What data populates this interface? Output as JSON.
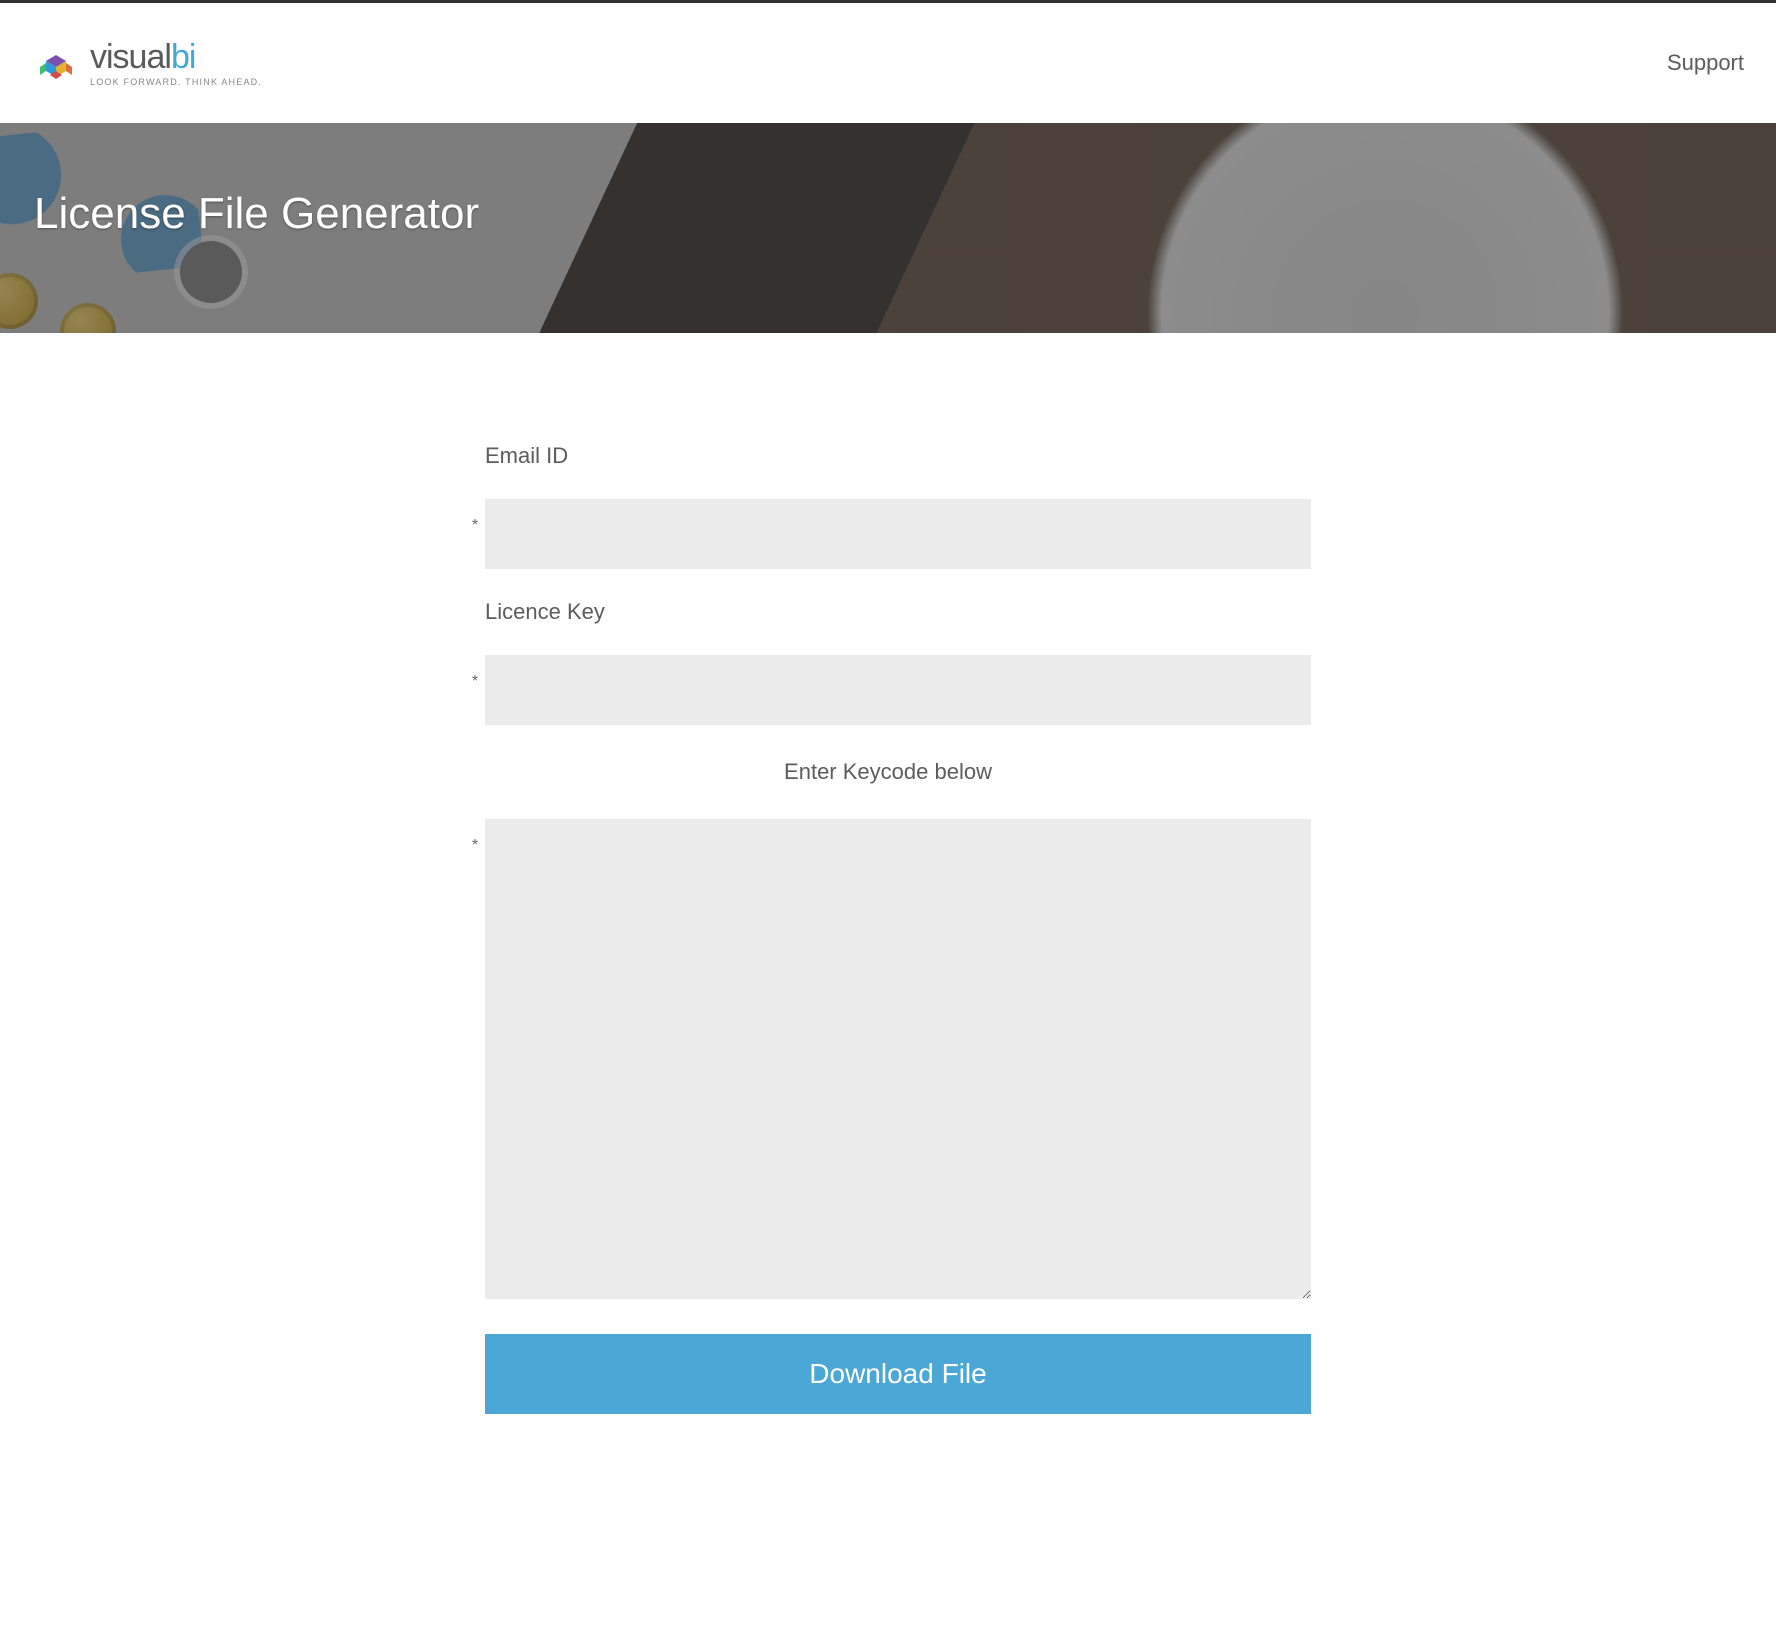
{
  "header": {
    "logo_main": "visual",
    "logo_accent": "bi",
    "logo_tagline": "LOOK FORWARD. THINK AHEAD.",
    "nav": {
      "support": "Support"
    }
  },
  "hero": {
    "title": "License File Generator"
  },
  "form": {
    "email_label": "Email ID",
    "email_required_mark": "*",
    "email_value": "",
    "licence_label": "Licence Key",
    "licence_required_mark": "*",
    "licence_value": "",
    "keycode_label": "Enter Keycode below",
    "keycode_required_mark": "*",
    "keycode_value": "",
    "submit_label": "Download File"
  },
  "colors": {
    "accent": "#4aa7d6",
    "text": "#5c5c5c",
    "input_bg": "#ebebeb"
  }
}
